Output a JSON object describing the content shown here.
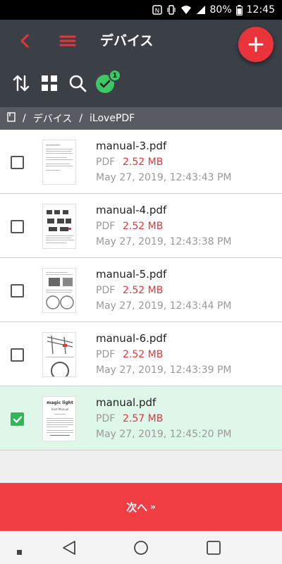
{
  "status_bar": {
    "battery": "80%",
    "time": "12:45"
  },
  "app_bar": {
    "title": "デバイス"
  },
  "breadcrumb": {
    "items": [
      "デバイス",
      "iLovePDF"
    ]
  },
  "selection": {
    "count": "1"
  },
  "files": [
    {
      "name": "manual-3.pdf",
      "type": "PDF",
      "size": "2.52 MB",
      "date": "May 27, 2019, 12:43:43 PM",
      "selected": false
    },
    {
      "name": "manual-4.pdf",
      "type": "PDF",
      "size": "2.52 MB",
      "date": "May 27, 2019, 12:43:38 PM",
      "selected": false
    },
    {
      "name": "manual-5.pdf",
      "type": "PDF",
      "size": "2.52 MB",
      "date": "May 27, 2019, 12:43:44 PM",
      "selected": false
    },
    {
      "name": "manual-6.pdf",
      "type": "PDF",
      "size": "2.52 MB",
      "date": "May 27, 2019, 12:43:39 PM",
      "selected": false
    },
    {
      "name": "manual.pdf",
      "type": "PDF",
      "size": "2.57 MB",
      "date": "May 27, 2019, 12:45:20 PM",
      "selected": true
    }
  ],
  "thumb5": {
    "logo_text": "magic light",
    "subtitle": "User Manual"
  },
  "next_button": {
    "label": "次へ",
    "arrow": "»"
  },
  "colors": {
    "accent": "#e8343a",
    "appbar": "#3b3f46",
    "selected_row": "#dff7e8",
    "check_green": "#3cc864"
  }
}
